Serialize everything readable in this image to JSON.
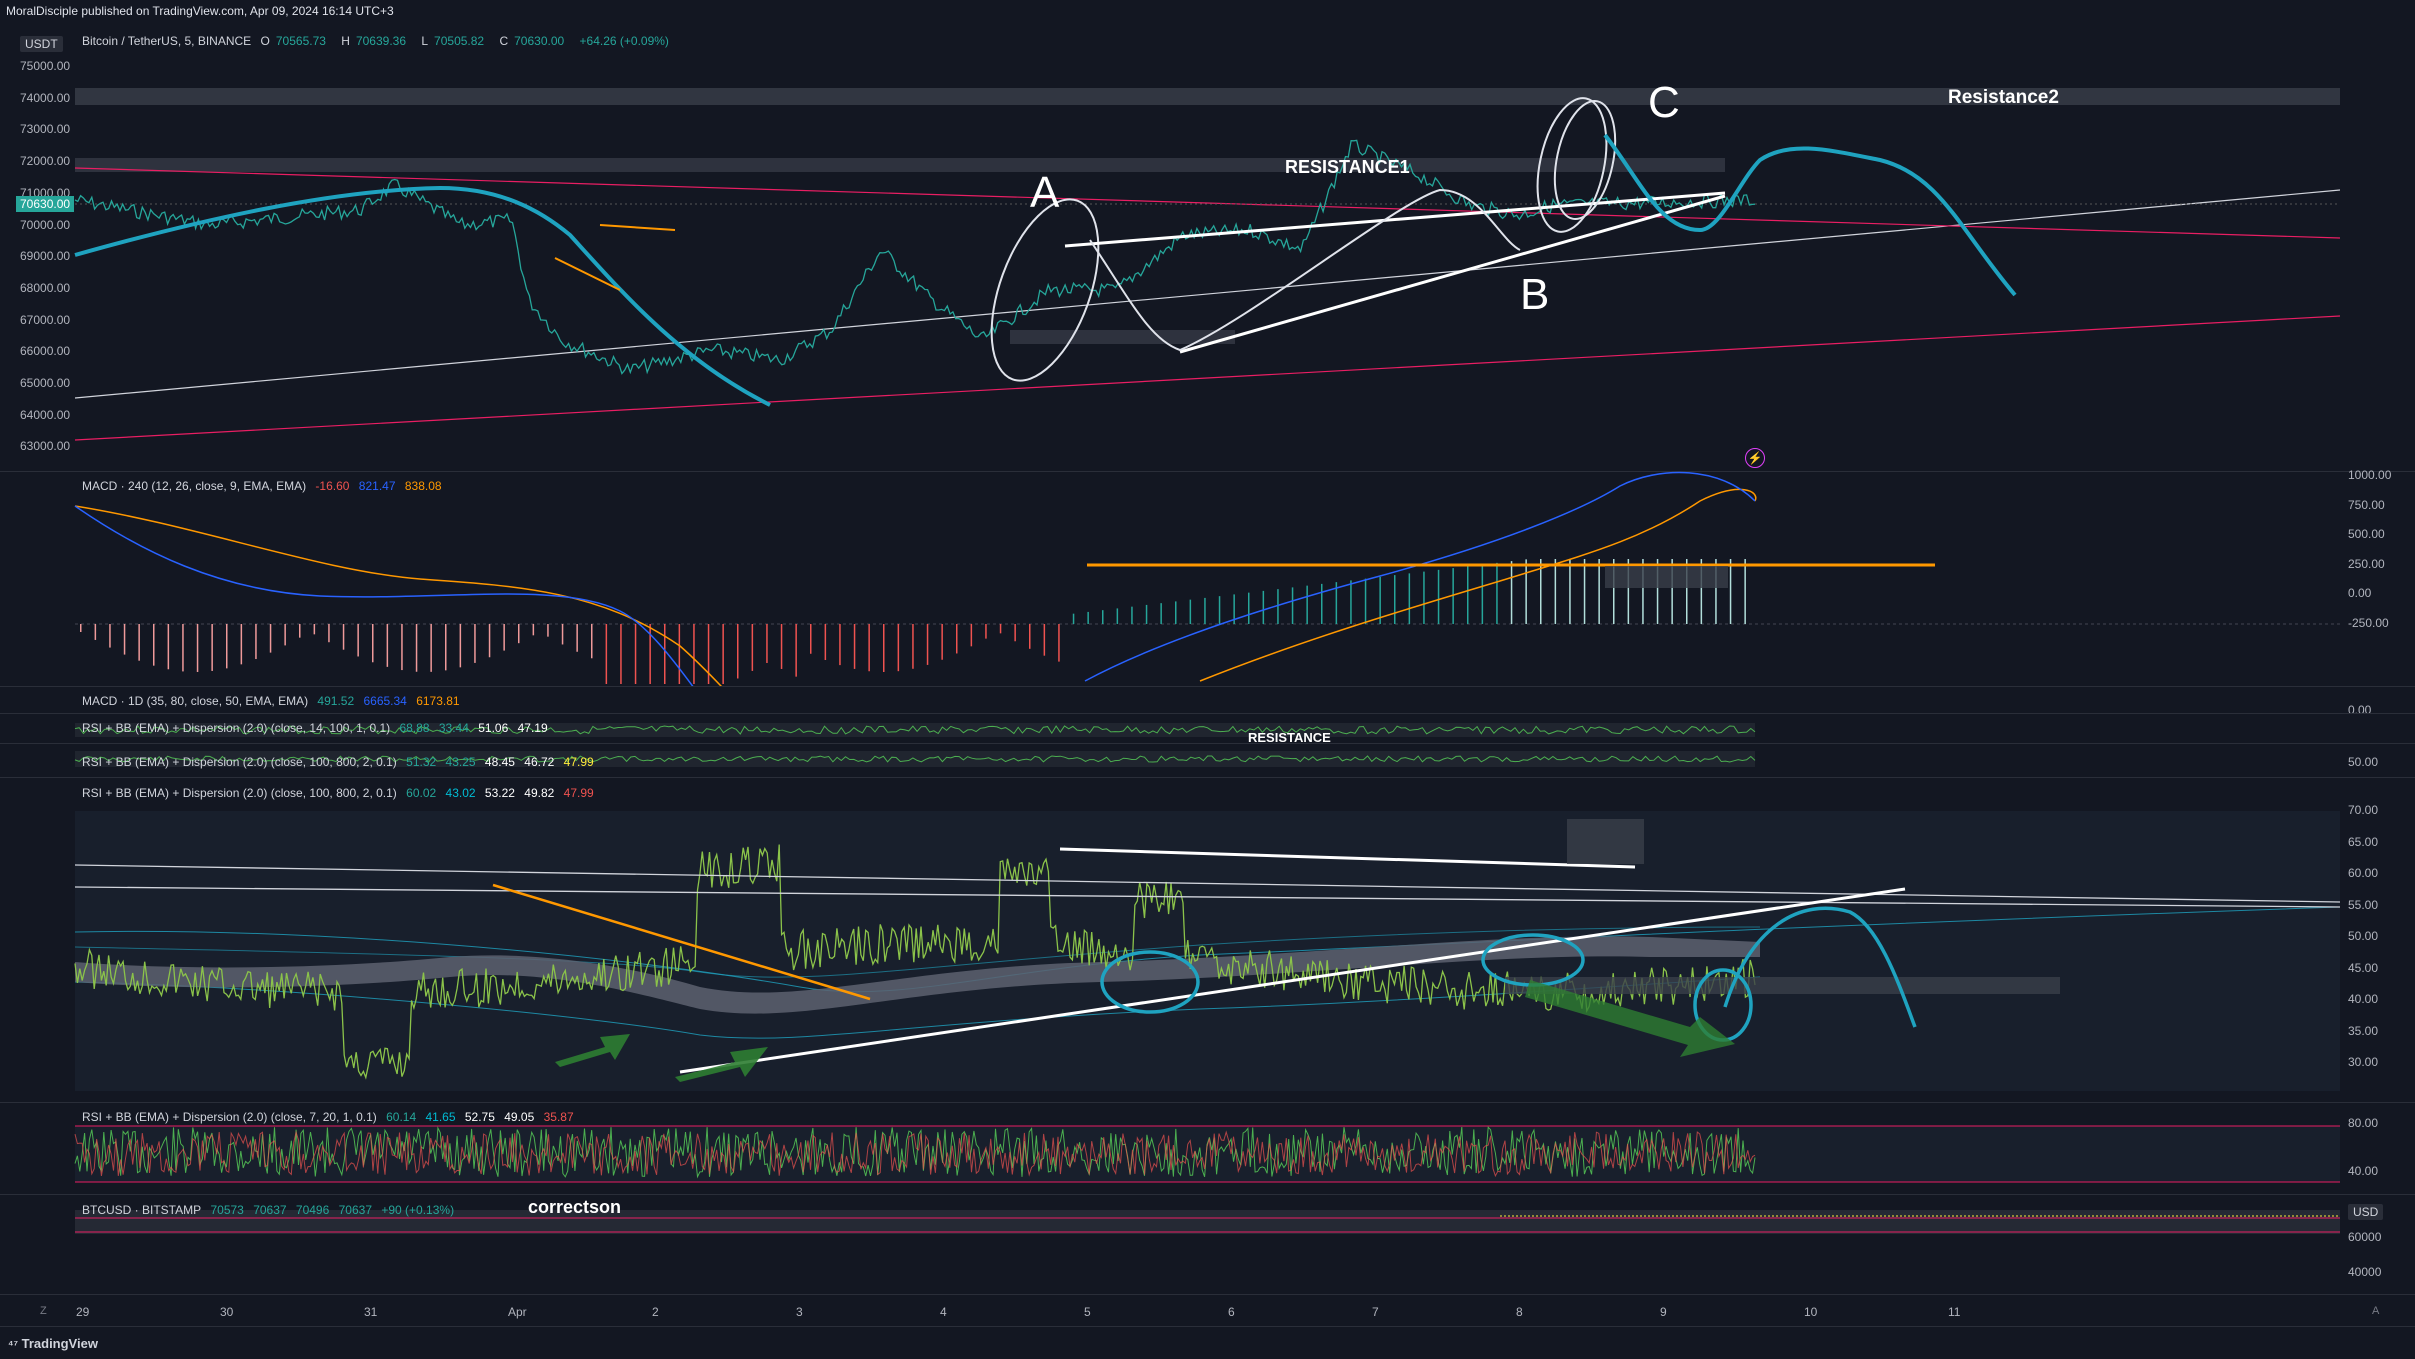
{
  "header": "MoralDisciple published on TradingView.com, Apr 09, 2024 16:14 UTC+3",
  "main": {
    "symbol": "Bitcoin / TetherUS, 5, BINANCE",
    "o_label": "O",
    "o": "70565.73",
    "h_label": "H",
    "h": "70639.36",
    "l_label": "L",
    "l": "70505.82",
    "c_label": "C",
    "c": "70630.00",
    "change": "+64.26 (+0.09%)",
    "currency": "USDT",
    "last_price": "70630.00",
    "y_labels": [
      "75000.00",
      "74000.00",
      "73000.00",
      "72000.00",
      "71000.00",
      "70000.00",
      "69000.00",
      "68000.00",
      "67000.00",
      "66000.00",
      "65000.00",
      "64000.00",
      "63000.00"
    ]
  },
  "annotations": {
    "resistance1": "RESISTANCE1",
    "resistance2": "Resistance2",
    "a": "A",
    "b": "B",
    "c": "C",
    "resistance_small": "RESISTANCE",
    "correction": "correctson"
  },
  "macd240": {
    "title": "MACD · 240 (12, 26, close, 9, EMA, EMA)",
    "v1": "-16.60",
    "v2": "821.47",
    "v3": "838.08",
    "y_labels": [
      "1000.00",
      "750.00",
      "500.00",
      "250.00",
      "0.00",
      "-250.00"
    ]
  },
  "macd1d": {
    "title": "MACD · 1D (35, 80, close, 50, EMA, EMA)",
    "v1": "491.52",
    "v2": "6665.34",
    "v3": "6173.81",
    "y_label": "0.00"
  },
  "rsi1": {
    "title": "RSI + BB (EMA) + Dispersion (2.0) (close, 14, 100, 1, 0.1)",
    "v1": "68.88",
    "v2": "33.44",
    "v3": "51.06",
    "v4": "47.19"
  },
  "rsi2": {
    "title": "RSI + BB (EMA) + Dispersion (2.0) (close, 100, 800, 2, 0.1)",
    "v1": "51.32",
    "v2": "43.25",
    "v3": "48.45",
    "v4": "46.72",
    "v5": "47.99",
    "y_label": "50.00"
  },
  "rsi3": {
    "title": "RSI + BB (EMA) + Dispersion (2.0) (close, 100, 800, 2, 0.1)",
    "v1": "60.02",
    "v2": "43.02",
    "v3": "53.22",
    "v4": "49.82",
    "v5": "47.99",
    "y_labels": [
      "70.00",
      "65.00",
      "60.00",
      "55.00",
      "50.00",
      "45.00",
      "40.00",
      "35.00",
      "30.00"
    ]
  },
  "rsi4": {
    "title": "RSI + BB (EMA) + Dispersion (2.0) (close, 7, 20, 1, 0.1)",
    "v1": "60.14",
    "v2": "41.65",
    "v3": "52.75",
    "v4": "49.05",
    "v5": "35.87",
    "y_labels": [
      "80.00",
      "40.00"
    ]
  },
  "btcusd": {
    "title": "BTCUSD · BITSTAMP",
    "o": "70573",
    "h": "70637",
    "l": "70496",
    "c": "70637",
    "change": "+90 (+0.13%)",
    "currency": "USD",
    "y_labels": [
      "60000",
      "40000"
    ]
  },
  "x_axis": [
    "29",
    "30",
    "31",
    "Apr",
    "2",
    "3",
    "4",
    "5",
    "6",
    "7",
    "8",
    "9",
    "10",
    "11"
  ],
  "footer": "TradingView",
  "colors": {
    "bg": "#131722",
    "teal": "#26a69a",
    "red": "#ef5350",
    "blue": "#2962ff",
    "orange": "#ff9800",
    "cyan_drawing": "#1fa3c0"
  }
}
